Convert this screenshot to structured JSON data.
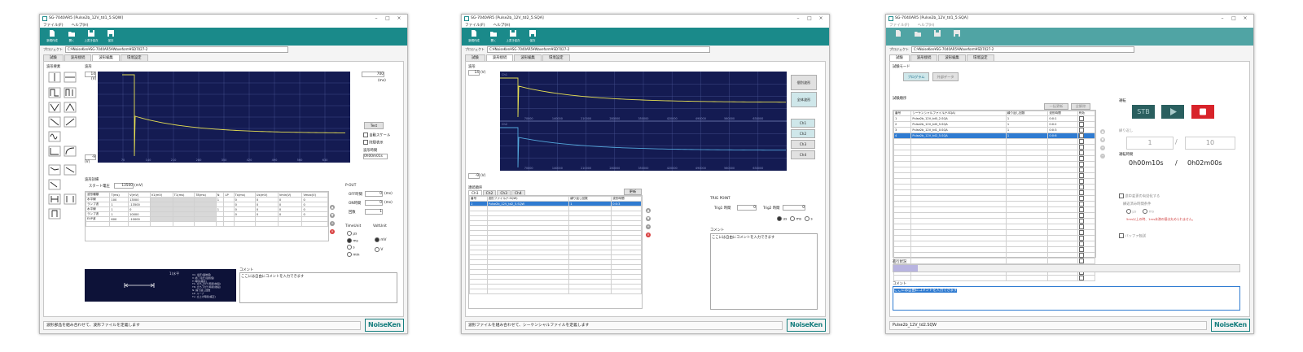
{
  "menu": [
    "ファイル(F)",
    "ヘルプ(H)"
  ],
  "toolbar": [
    "新規作成",
    "開く",
    "上書き保存",
    "保存"
  ],
  "project_label": "プロジェクト",
  "project_path": "C:¥NoiseKen¥SG-7040AR5¥Waveform¥SD7027-2",
  "tabs": [
    "試験",
    "波形接続",
    "波形編集",
    "環境設定"
  ],
  "win1": {
    "title": "SG-7040AR5 [Pulse2b_12V_td1_5.SQW]",
    "parts_title": "波形要素",
    "wave_title": "波形",
    "y_top": "14",
    "y_bottom": "-9",
    "y_unit_top": "(V)",
    "y_unit_bottom": "(V)",
    "x_max": "700",
    "x_unit": "(ms)",
    "x_ticks": [
      "70",
      "140",
      "210",
      "280",
      "350",
      "420",
      "490",
      "560",
      "630"
    ],
    "test_button": "Test",
    "auto_scale_label": "自動スケール",
    "grid_label": "除隠表示",
    "wave_time_label": "波形時間",
    "wave_time_value": "0h00m01s",
    "detail_title": "波形詳細",
    "start_voltage_label": "スタート電圧",
    "start_voltage_value": "13500",
    "start_voltage_unit": "(mV)",
    "table_headers": [
      "波形種類",
      "T(ms)",
      "V(mV)",
      "V1(mV)",
      "T1(ms)",
      "T8(ms)",
      "N",
      "LP",
      "Tx(ms)",
      "Ux(mV)",
      "Vmin(V)",
      "Vmax(V)"
    ],
    "table_rows": [
      [
        "水平線",
        "100",
        "13500",
        "",
        "",
        "",
        "1",
        "",
        "0",
        "0",
        "0",
        "0"
      ],
      [
        "ランプ波",
        "1",
        "-13500",
        "",
        "",
        "",
        "",
        "",
        "0",
        "0",
        "0",
        "0"
      ],
      [
        "水平線",
        "1",
        "0",
        "",
        "",
        "",
        "1",
        "",
        "0",
        "0",
        "0",
        "0"
      ],
      [
        "ランプ波",
        "1",
        "10000",
        "",
        "",
        "",
        "",
        "",
        "0",
        "0",
        "0",
        "0"
      ],
      [
        "EXP波",
        "600",
        "-10000",
        "",
        "",
        "",
        "",
        "",
        "",
        "",
        "",
        ""
      ]
    ],
    "pout_title": "P-OUT",
    "off_time_label": "OFF時間",
    "off_time_value": "0",
    "off_time_unit": "(ms)",
    "on_time_label": "ON時間",
    "on_time_value": "0",
    "on_time_unit": "(ms)",
    "repeat_label": "回数",
    "repeat_value": "1",
    "time_unit_title": "TimeUnit",
    "time_units": [
      "μs",
      "ms",
      "s",
      "min"
    ],
    "volt_unit_title": "VoltUnit",
    "volt_units": [
      "mV",
      "V"
    ],
    "help_title": "1)水平",
    "help_lines": [
      "V1: 電圧(開始値)",
      "V: 終了電圧(最終値)",
      "T: 時間(継続)",
      "T1: 立ち上がり時間(前段)",
      "T8: 立ち下がり時間(後段)",
      "N: 繰り返し回数",
      "LP: ループ",
      "Tx: 立上げ時間(補正)"
    ],
    "comment_label": "コメント",
    "comment_text": "ここには自由にコメントを入力できます",
    "status": "波形部品を組み合わせて、波形ファイルを定義します",
    "logo": "NoiseKen"
  },
  "win2": {
    "title": "SG-7040AR5 [Pulse2b_12V_td2_5.SQA]",
    "wave_title": "波形",
    "y_top": "14",
    "y_bottom": "-9",
    "y_unit": "(V)",
    "ch1_tag": "Ch1",
    "ch2_tag": "Ch2",
    "x_ticks": [
      "70000",
      "140000",
      "210000",
      "280000",
      "350000",
      "420000",
      "490000",
      "560000",
      "630000"
    ],
    "split_button": "個別波形",
    "all_button": "全体波形",
    "ch_buttons": [
      "Ch1",
      "Ch2",
      "Ch3",
      "Ch4"
    ],
    "seq_title": "連続順序",
    "seq_tabs": [
      "Ch1",
      "Ch2",
      "Ch3",
      "Ch4"
    ],
    "update_button": "更新",
    "seq_headers": [
      "番号",
      "波形ファイル(*.SQW)",
      "繰り返し回数",
      "波形時間"
    ],
    "seq_rows": [
      [
        "1",
        "Pulse2b_12V_td2_5.SQW",
        "1",
        "0:0:3"
      ]
    ],
    "trig_title": "TRIG POINT",
    "trig1_label": "Trig1 時間",
    "trig1_value": "0",
    "trig2_label": "Trig2 時間",
    "trig2_value": "0",
    "trig_units": [
      "us",
      "ms",
      "s"
    ],
    "comment_label": "コメント",
    "comment_text": "ここには自由にコメントを入力できます",
    "status": "波形ファイルを組み合わせて、シーケンシャルファイルを定義します",
    "logo": "NoiseKen"
  },
  "win3": {
    "title": "SG-7040AR5 [Pulse2b_12V_td1_5.SQA]",
    "mode_title": "試験モード",
    "mode_buttons": [
      "プログラム",
      "外部データ"
    ],
    "order_title": "試験順序",
    "order_buttons": [
      "一括更新",
      "全解除"
    ],
    "order_headers": [
      "番号",
      "シーケンシャルファイル(*.SQA)",
      "繰り返し回数",
      "波形時間",
      "有効"
    ],
    "order_rows": [
      [
        "1",
        "Pulse2b_12V_td0_2.SQA",
        "1",
        "0:0:1"
      ],
      [
        "2",
        "Pulse2b_12V_td0_5.SQA",
        "1",
        "0:0:2"
      ],
      [
        "3",
        "Pulse2b_12V_td1_0.SQA",
        "1",
        "0:0:3"
      ],
      [
        "4",
        "Pulse2b_12V_td2_5.SQA",
        "1",
        "0:0:6"
      ]
    ],
    "run_title": "運転",
    "stb_label": "STB",
    "repeat_title": "繰り返し",
    "repeat_current": "1",
    "repeat_sep": "/",
    "repeat_total": "10",
    "time_title": "運転時間",
    "time_elapsed": "0h00m10s",
    "time_sep": "/",
    "time_total": "0h02m00s",
    "option1": "途中変更の有効化する",
    "remaining_title": "繰返済み時間条件",
    "remaining_units": [
      "μs",
      "ms"
    ],
    "remaining_note": "5ms以上の時、1ms未満の値は丸められません。",
    "option2": "バッファ転送",
    "progress_title": "進行状況",
    "progress_value": 0.07,
    "comment_label": "コメント",
    "comment_text": "ここには自由にコメントを入力できます",
    "status": "Pulse2b_12V_td2.SQW",
    "logo": "NoiseKen"
  },
  "colors": {
    "teal": "#1a8a8a",
    "plot_bg": "#141b52",
    "trace": "#e6df52",
    "trace2": "#54a8dc",
    "select": "#2f7bd1",
    "run_red": "#d8232a",
    "stb_green": "#2a5f5f"
  }
}
